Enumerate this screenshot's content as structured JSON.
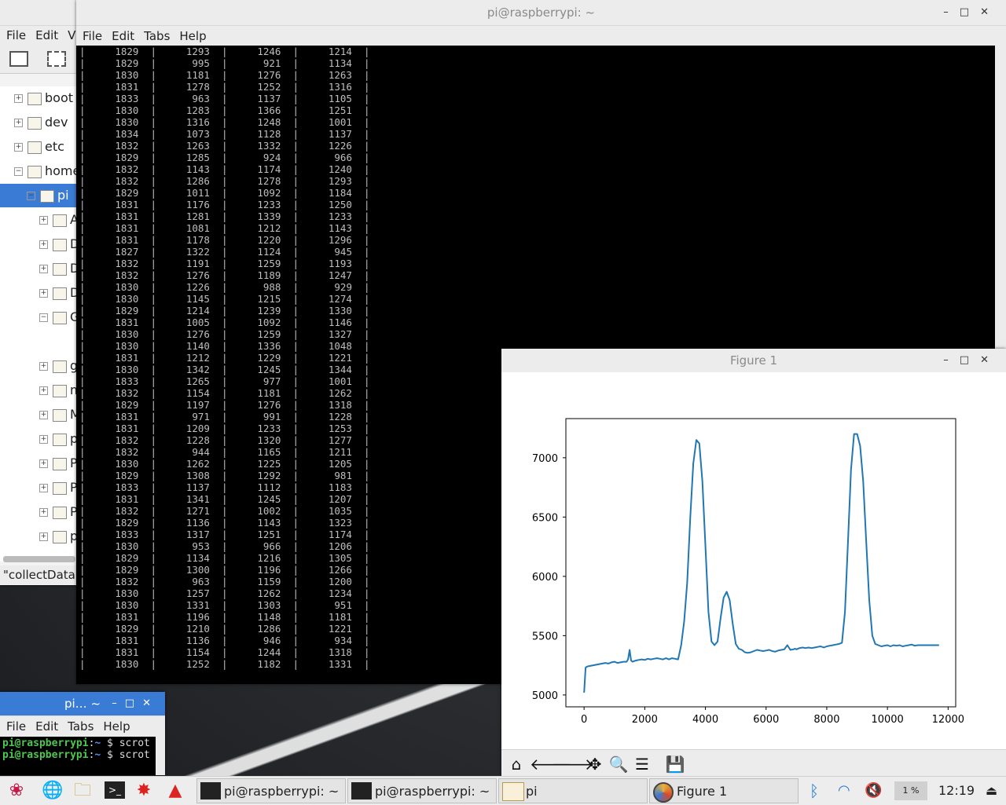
{
  "file_manager": {
    "menu": [
      "File",
      "Edit",
      "V"
    ],
    "tree": [
      {
        "label": "boot",
        "expander": "+"
      },
      {
        "label": "dev",
        "expander": "+"
      },
      {
        "label": "etc",
        "expander": "+"
      },
      {
        "label": "home",
        "expander": "−"
      },
      {
        "label": "pi",
        "expander": "−",
        "selected": true
      },
      {
        "label": "A",
        "expander": "+"
      },
      {
        "label": "D",
        "expander": "+"
      },
      {
        "label": "D",
        "expander": "+"
      },
      {
        "label": "D",
        "expander": "+"
      },
      {
        "label": "G",
        "expander": "−"
      },
      {
        "label": "gi",
        "expander": "+"
      },
      {
        "label": "m",
        "expander": "+"
      },
      {
        "label": "M",
        "expander": "+"
      },
      {
        "label": "pe",
        "expander": "+"
      },
      {
        "label": "P",
        "expander": "+"
      },
      {
        "label": "P",
        "expander": "+"
      },
      {
        "label": "P",
        "expander": "+"
      },
      {
        "label": "py",
        "expander": "+"
      }
    ],
    "status": "\"collectData.p"
  },
  "terminal_main": {
    "title": "pi@raspberrypi: ~",
    "menu": [
      "File",
      "Edit",
      "Tabs",
      "Help"
    ],
    "rows": [
      [
        "1829",
        "1293",
        "1246",
        "1214"
      ],
      [
        "1829",
        "995",
        "921",
        "1134"
      ],
      [
        "1830",
        "1181",
        "1276",
        "1263"
      ],
      [
        "1831",
        "1278",
        "1252",
        "1316"
      ],
      [
        "1833",
        "963",
        "1137",
        "1105"
      ],
      [
        "1830",
        "1283",
        "1366",
        "1251"
      ],
      [
        "1830",
        "1316",
        "1248",
        "1001"
      ],
      [
        "1834",
        "1073",
        "1128",
        "1137"
      ],
      [
        "1832",
        "1263",
        "1332",
        "1226"
      ],
      [
        "1829",
        "1285",
        "924",
        "966"
      ],
      [
        "1832",
        "1143",
        "1174",
        "1240"
      ],
      [
        "1832",
        "1286",
        "1278",
        "1293"
      ],
      [
        "1829",
        "1011",
        "1092",
        "1184"
      ],
      [
        "1831",
        "1176",
        "1233",
        "1250"
      ],
      [
        "1831",
        "1281",
        "1339",
        "1233"
      ],
      [
        "1831",
        "1081",
        "1212",
        "1143"
      ],
      [
        "1831",
        "1178",
        "1220",
        "1296"
      ],
      [
        "1827",
        "1322",
        "1124",
        "945"
      ],
      [
        "1832",
        "1191",
        "1259",
        "1193"
      ],
      [
        "1832",
        "1276",
        "1189",
        "1247"
      ],
      [
        "1830",
        "1226",
        "988",
        "929"
      ],
      [
        "1830",
        "1145",
        "1215",
        "1274"
      ],
      [
        "1829",
        "1214",
        "1239",
        "1330"
      ],
      [
        "1831",
        "1005",
        "1092",
        "1146"
      ],
      [
        "1830",
        "1276",
        "1259",
        "1327"
      ],
      [
        "1830",
        "1140",
        "1336",
        "1048"
      ],
      [
        "1831",
        "1212",
        "1229",
        "1221"
      ],
      [
        "1830",
        "1342",
        "1245",
        "1344"
      ],
      [
        "1833",
        "1265",
        "977",
        "1001"
      ],
      [
        "1832",
        "1154",
        "1181",
        "1262"
      ],
      [
        "1829",
        "1197",
        "1276",
        "1318"
      ],
      [
        "1831",
        "971",
        "991",
        "1228"
      ],
      [
        "1831",
        "1209",
        "1233",
        "1253"
      ],
      [
        "1832",
        "1228",
        "1320",
        "1277"
      ],
      [
        "1832",
        "944",
        "1165",
        "1211"
      ],
      [
        "1830",
        "1262",
        "1225",
        "1205"
      ],
      [
        "1829",
        "1308",
        "1292",
        "981"
      ],
      [
        "1833",
        "1137",
        "1112",
        "1183"
      ],
      [
        "1831",
        "1341",
        "1245",
        "1207"
      ],
      [
        "1832",
        "1271",
        "1002",
        "1035"
      ],
      [
        "1829",
        "1136",
        "1143",
        "1323"
      ],
      [
        "1833",
        "1317",
        "1251",
        "1174"
      ],
      [
        "1830",
        "953",
        "966",
        "1206"
      ],
      [
        "1829",
        "1134",
        "1216",
        "1305"
      ],
      [
        "1829",
        "1300",
        "1196",
        "1266"
      ],
      [
        "1832",
        "963",
        "1159",
        "1200"
      ],
      [
        "1830",
        "1257",
        "1262",
        "1234"
      ],
      [
        "1830",
        "1331",
        "1303",
        "951"
      ],
      [
        "1831",
        "1196",
        "1148",
        "1181"
      ],
      [
        "1829",
        "1210",
        "1286",
        "1221"
      ],
      [
        "1831",
        "1136",
        "946",
        "934"
      ],
      [
        "1831",
        "1154",
        "1244",
        "1318"
      ],
      [
        "1830",
        "1252",
        "1182",
        "1331"
      ]
    ]
  },
  "figure": {
    "title": "Figure 1",
    "toolbar": [
      "home-icon",
      "back-arrow-icon",
      "forward-arrow-icon",
      "pan-icon",
      "zoom-icon",
      "configure-subplots-icon",
      "save-icon"
    ]
  },
  "chart_data": {
    "type": "line",
    "title": "",
    "xlabel": "",
    "ylabel": "",
    "xlim": [
      -600,
      12250
    ],
    "ylim": [
      4900,
      7330
    ],
    "xticks": [
      0,
      2000,
      4000,
      6000,
      8000,
      10000,
      12000
    ],
    "yticks": [
      5000,
      5500,
      6000,
      6500,
      7000
    ],
    "grid": false,
    "color": "#1f77b4",
    "x": [
      0,
      50,
      100,
      200,
      300,
      400,
      500,
      600,
      700,
      800,
      900,
      1000,
      1100,
      1200,
      1300,
      1400,
      1450,
      1500,
      1550,
      1600,
      1700,
      1800,
      1900,
      2000,
      2100,
      2200,
      2300,
      2400,
      2500,
      2600,
      2700,
      2800,
      2900,
      3000,
      3100,
      3200,
      3300,
      3400,
      3500,
      3600,
      3700,
      3800,
      3900,
      4000,
      4100,
      4200,
      4300,
      4400,
      4500,
      4600,
      4700,
      4800,
      4900,
      5000,
      5100,
      5200,
      5300,
      5400,
      5500,
      5600,
      5700,
      5800,
      5900,
      6000,
      6100,
      6200,
      6300,
      6400,
      6500,
      6600,
      6700,
      6800,
      6900,
      6950,
      7000,
      7100,
      7200,
      7300,
      7400,
      7500,
      7600,
      7700,
      7800,
      7900,
      8000,
      8100,
      8200,
      8300,
      8400,
      8500,
      8600,
      8700,
      8800,
      8900,
      9000,
      9100,
      9200,
      9300,
      9400,
      9500,
      9600,
      9700,
      9800,
      9900,
      10000,
      10100,
      10200,
      10300,
      10400,
      10500,
      10600,
      10700,
      10800,
      10900,
      11000,
      11100,
      11200,
      11300,
      11400,
      11500,
      11600,
      11700
    ],
    "y": [
      5020,
      5230,
      5240,
      5245,
      5250,
      5255,
      5260,
      5265,
      5270,
      5265,
      5275,
      5280,
      5270,
      5275,
      5280,
      5280,
      5300,
      5380,
      5290,
      5280,
      5290,
      5295,
      5300,
      5295,
      5305,
      5300,
      5305,
      5310,
      5305,
      5300,
      5310,
      5300,
      5310,
      5305,
      5300,
      5420,
      5620,
      5950,
      6500,
      6950,
      7150,
      7120,
      6800,
      6250,
      5700,
      5450,
      5420,
      5450,
      5650,
      5820,
      5870,
      5800,
      5600,
      5430,
      5390,
      5380,
      5360,
      5355,
      5360,
      5370,
      5380,
      5375,
      5370,
      5375,
      5380,
      5370,
      5365,
      5375,
      5380,
      5385,
      5420,
      5380,
      5385,
      5390,
      5385,
      5395,
      5400,
      5395,
      5400,
      5395,
      5400,
      5405,
      5410,
      5400,
      5410,
      5415,
      5420,
      5425,
      5430,
      5440,
      5700,
      6300,
      6900,
      7200,
      7200,
      7100,
      6800,
      6300,
      5800,
      5500,
      5430,
      5420,
      5410,
      5415,
      5420,
      5410,
      5420,
      5415,
      5420,
      5410,
      5415,
      5420,
      5425,
      5415,
      5420,
      5420,
      5420,
      5420,
      5420,
      5420,
      5420,
      5420
    ]
  },
  "terminal_small": {
    "title": "pi… ~",
    "menu": [
      "File",
      "Edit",
      "Tabs",
      "Help"
    ],
    "lines": [
      {
        "prompt": "pi@raspberrypi",
        "sep": ":",
        "path": "~",
        "cmd": " $ scrot"
      },
      {
        "prompt": "pi@raspberrypi",
        "sep": ":",
        "path": "~",
        "cmd": " $ scrot"
      }
    ]
  },
  "taskbar": {
    "tasks": [
      {
        "label": "pi@raspberrypi: ~",
        "icon": "terminal-icon"
      },
      {
        "label": "pi@raspberrypi: ~",
        "icon": "terminal-icon"
      },
      {
        "label": "pi",
        "icon": "folder-icon"
      },
      {
        "label": "Figure 1",
        "icon": "matplotlib-icon"
      }
    ],
    "cpu": "1 %",
    "clock": "12:19"
  }
}
